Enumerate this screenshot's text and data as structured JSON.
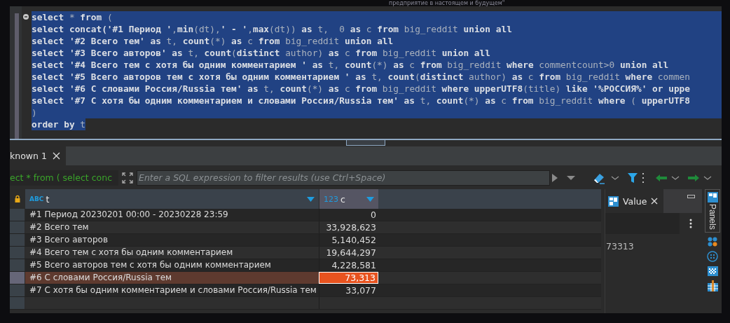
{
  "background_text": "предприятие в настоящем и будущем\"",
  "editor": {
    "selection_ends_at_text_end": true,
    "lines": [
      {
        "selected": true,
        "segments": [
          {
            "text": "select",
            "kind": "bold"
          },
          {
            "text": " * ",
            "kind": "plain"
          },
          {
            "text": "from",
            "kind": "bold"
          },
          {
            "text": " (",
            "kind": "plain"
          }
        ]
      },
      {
        "selected": true,
        "segments": [
          {
            "text": "select concat('#1 Период '",
            "kind": "bold"
          },
          {
            "text": ",",
            "kind": "plain"
          },
          {
            "text": "min",
            "kind": "bold"
          },
          {
            "text": "(dt),",
            "kind": "plain"
          },
          {
            "text": "' - '",
            "kind": "bold"
          },
          {
            "text": ",",
            "kind": "plain"
          },
          {
            "text": "max",
            "kind": "bold"
          },
          {
            "text": "(dt)) ",
            "kind": "plain"
          },
          {
            "text": "as",
            "kind": "bold"
          },
          {
            "text": " t,  0 ",
            "kind": "plain"
          },
          {
            "text": "as",
            "kind": "bold"
          },
          {
            "text": " c ",
            "kind": "plain"
          },
          {
            "text": "from",
            "kind": "bold"
          },
          {
            "text": " big_reddit ",
            "kind": "plain"
          },
          {
            "text": "union all",
            "kind": "bold"
          }
        ]
      },
      {
        "selected": true,
        "segments": [
          {
            "text": "select '#2 Всего тем' as",
            "kind": "bold"
          },
          {
            "text": " t, ",
            "kind": "plain"
          },
          {
            "text": "count",
            "kind": "bold"
          },
          {
            "text": "(*) ",
            "kind": "plain"
          },
          {
            "text": "as",
            "kind": "bold"
          },
          {
            "text": " c ",
            "kind": "plain"
          },
          {
            "text": "from",
            "kind": "bold"
          },
          {
            "text": " big_reddit ",
            "kind": "plain"
          },
          {
            "text": "union all",
            "kind": "bold"
          }
        ]
      },
      {
        "selected": true,
        "segments": [
          {
            "text": "select '#3 Всего авторов' as",
            "kind": "bold"
          },
          {
            "text": " t, ",
            "kind": "plain"
          },
          {
            "text": "count",
            "kind": "bold"
          },
          {
            "text": "(",
            "kind": "plain"
          },
          {
            "text": "distinct",
            "kind": "bold"
          },
          {
            "text": " author) ",
            "kind": "plain"
          },
          {
            "text": "as",
            "kind": "bold"
          },
          {
            "text": " c ",
            "kind": "plain"
          },
          {
            "text": "from",
            "kind": "bold"
          },
          {
            "text": " big_reddit ",
            "kind": "plain"
          },
          {
            "text": "union all",
            "kind": "bold"
          }
        ]
      },
      {
        "selected": true,
        "segments": [
          {
            "text": "select '#4 Всего тем с хотя бы одним комментарием ' as",
            "kind": "bold"
          },
          {
            "text": " t, ",
            "kind": "plain"
          },
          {
            "text": "count",
            "kind": "bold"
          },
          {
            "text": "(*) ",
            "kind": "plain"
          },
          {
            "text": "as",
            "kind": "bold"
          },
          {
            "text": " c ",
            "kind": "plain"
          },
          {
            "text": "from",
            "kind": "bold"
          },
          {
            "text": " big_reddit ",
            "kind": "plain"
          },
          {
            "text": "where",
            "kind": "bold"
          },
          {
            "text": " commentcount>0 ",
            "kind": "plain"
          },
          {
            "text": "union all",
            "kind": "bold"
          }
        ]
      },
      {
        "selected": true,
        "segments": [
          {
            "text": "select '#5 Всего авторов тем с хотя бы одним комментарием ' as",
            "kind": "bold"
          },
          {
            "text": " t, ",
            "kind": "plain"
          },
          {
            "text": "count",
            "kind": "bold"
          },
          {
            "text": "(",
            "kind": "plain"
          },
          {
            "text": "distinct",
            "kind": "bold"
          },
          {
            "text": " author) ",
            "kind": "plain"
          },
          {
            "text": "as",
            "kind": "bold"
          },
          {
            "text": " c ",
            "kind": "plain"
          },
          {
            "text": "from",
            "kind": "bold"
          },
          {
            "text": " big_reddit ",
            "kind": "plain"
          },
          {
            "text": "where",
            "kind": "bold"
          },
          {
            "text": " commen",
            "kind": "plain"
          }
        ]
      },
      {
        "selected": true,
        "segments": [
          {
            "text": "select '#6 С словами Россия/Russia тем' as",
            "kind": "bold"
          },
          {
            "text": " t, ",
            "kind": "plain"
          },
          {
            "text": "count",
            "kind": "bold"
          },
          {
            "text": "(*) ",
            "kind": "plain"
          },
          {
            "text": "as",
            "kind": "bold"
          },
          {
            "text": " c ",
            "kind": "plain"
          },
          {
            "text": "from",
            "kind": "bold"
          },
          {
            "text": " big_reddit ",
            "kind": "plain"
          },
          {
            "text": "where upperUTF8",
            "kind": "bold"
          },
          {
            "text": "(title) ",
            "kind": "plain"
          },
          {
            "text": "like '%РОССИЯ%' or uppe",
            "kind": "bold"
          }
        ]
      },
      {
        "selected": true,
        "segments": [
          {
            "text": "select '#7 С хотя бы одним комментарием и словами Россия/Russia тем' as",
            "kind": "bold"
          },
          {
            "text": " t, ",
            "kind": "plain"
          },
          {
            "text": "count",
            "kind": "bold"
          },
          {
            "text": "(*) ",
            "kind": "plain"
          },
          {
            "text": "as",
            "kind": "bold"
          },
          {
            "text": " c ",
            "kind": "plain"
          },
          {
            "text": "from",
            "kind": "bold"
          },
          {
            "text": " big_reddit ",
            "kind": "plain"
          },
          {
            "text": "where",
            "kind": "bold"
          },
          {
            "text": " ( ",
            "kind": "plain"
          },
          {
            "text": "upperUTF8",
            "kind": "bold"
          }
        ]
      },
      {
        "selected": true,
        "segments": [
          {
            "text": ")",
            "kind": "plain"
          }
        ]
      },
      {
        "selected": true,
        "segments": [
          {
            "text": "order by",
            "kind": "bold"
          },
          {
            "text": " t",
            "kind": "plain"
          }
        ]
      }
    ]
  },
  "results": {
    "tabs": [
      {
        "label": "known 1",
        "selected": true
      }
    ],
    "filter": {
      "query_preview": "ect * from ( select conc",
      "placeholder": "Enter a SQL expression to filter results (use Ctrl+Space)"
    },
    "columns": [
      {
        "type_label": "ABC",
        "name": "t",
        "selected": false
      },
      {
        "type_label": "123",
        "name": "c",
        "selected": true
      }
    ],
    "rows": [
      {
        "t": "#1 Период 20230201 00:00 - 20230228 23:59",
        "c": "0",
        "selected": false
      },
      {
        "t": "#2 Всего тем",
        "c": "33,928,623",
        "selected": false
      },
      {
        "t": "#3 Всего авторов",
        "c": "5,140,452",
        "selected": false
      },
      {
        "t": "#4 Всего тем с хотя бы одним комментарием",
        "c": "19,644,297",
        "selected": false
      },
      {
        "t": "#5 Всего авторов тем с хотя бы одним комментарием",
        "c": "4,228,581",
        "selected": false
      },
      {
        "t": "#6 С словами Россия/Russia тем",
        "c": "73,313",
        "selected": true
      },
      {
        "t": "#7 С хотя бы одним комментарием и словами Россия/Russia тем",
        "c": "33,077",
        "selected": false
      }
    ]
  },
  "value_panel": {
    "tab": "Value",
    "value": "73313"
  },
  "side_bar": {
    "label": "Panels"
  }
}
